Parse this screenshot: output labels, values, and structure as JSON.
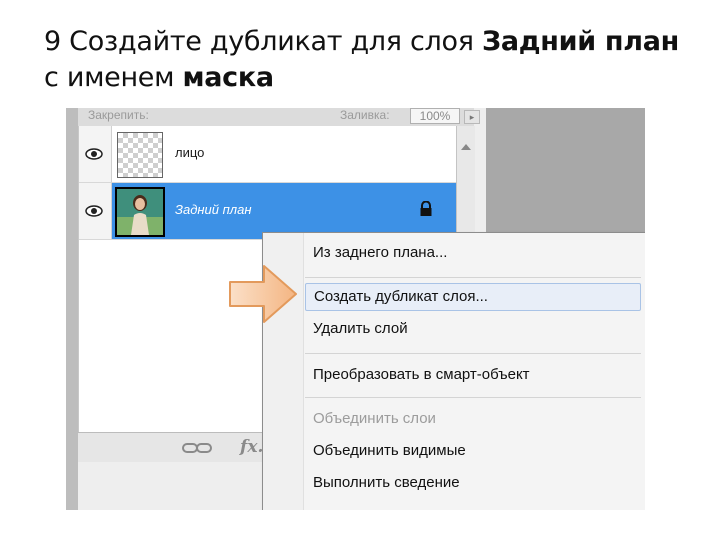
{
  "slide": {
    "title_prefix": "9 Создайте дубликат для слоя ",
    "title_bold1": "Задний план",
    "title_mid": " с именем ",
    "title_bold2": "маска"
  },
  "panel": {
    "lock_label": "Закрепить:",
    "fill_label": "Заливка:",
    "fill_value": "100%",
    "layers": [
      {
        "name": "лицо",
        "selected": false,
        "thumb": "transparent"
      },
      {
        "name": "Задний план",
        "selected": true,
        "thumb": "photo",
        "locked": true
      }
    ]
  },
  "context_menu": {
    "items": [
      {
        "label": "Из заднего плана...",
        "state": "normal"
      },
      {
        "label": "Создать дубликат слоя...",
        "state": "hover"
      },
      {
        "label": "Удалить слой",
        "state": "normal"
      },
      {
        "label": "Преобразовать в смарт-объект",
        "state": "normal"
      },
      {
        "label": "Объединить слои",
        "state": "disabled"
      },
      {
        "label": "Объединить видимые",
        "state": "normal"
      },
      {
        "label": "Выполнить сведение",
        "state": "normal"
      }
    ]
  },
  "colors": {
    "selection": "#3d91e6",
    "arrow_fill": "#f7c9a0",
    "arrow_stroke": "#e39a5c"
  }
}
